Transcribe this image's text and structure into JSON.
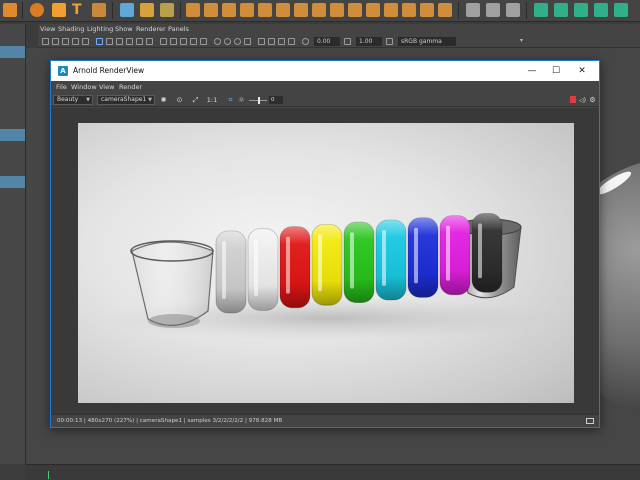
{
  "maya": {
    "viewport_menu": [
      "View",
      "Shading",
      "Lighting",
      "Show",
      "Renderer",
      "Panels"
    ],
    "exposure_value": "0.00",
    "gamma_value": "1.00",
    "color_space": "sRGB gamma"
  },
  "renderview": {
    "title": "Arnold RenderView",
    "app_icon_letter": "A",
    "window_controls": {
      "minimize": "—",
      "maximize": "☐",
      "close": "✕"
    },
    "menu": [
      "File",
      "Window",
      "View",
      "Render"
    ],
    "aov_select": "Beauty",
    "camera_select": "cameraShape1",
    "zoom_ratio": "1:1",
    "exposure_field": "0",
    "status": "00:00:13 | 480x270 (227%) | cameraShape1 | samples 3/2/2/2/2/2 | 978.828 MB"
  },
  "colors": {
    "accent_blue": "#1d7ad6",
    "ring_colors": [
      "#cfcfcf",
      "#eeeeee",
      "#e01515",
      "#f2e80a",
      "#28c41c",
      "#18c8e0",
      "#1c2fd8",
      "#e21ee0",
      "#2e2e2e"
    ]
  },
  "icons": [
    "arnold-app-icon",
    "minimize-icon",
    "maximize-icon",
    "close-icon",
    "render-icon",
    "stop-icon",
    "zoom-fit-icon",
    "exposure-icon",
    "record-icon",
    "speaker-icon",
    "gear-icon",
    "snapshot-icon"
  ]
}
